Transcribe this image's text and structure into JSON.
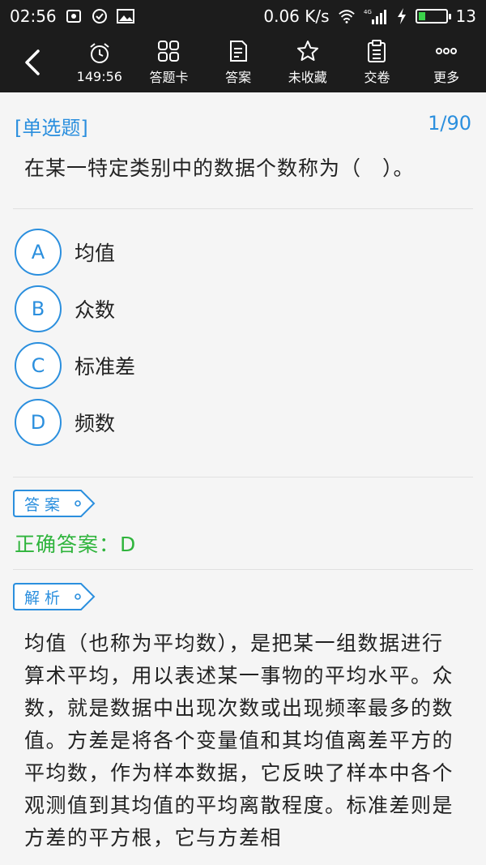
{
  "status_bar": {
    "time": "02:56",
    "network_speed": "0.06 K/s",
    "signal_label": "4G",
    "battery": "13",
    "left_icons": [
      "bug-icon",
      "check-circle-icon",
      "image-icon"
    ],
    "right_icons": [
      "wifi-icon",
      "signal-icon",
      "charging-icon",
      "battery-icon"
    ]
  },
  "toolbar": {
    "back_icon": "back-arrow-icon",
    "items": [
      {
        "icon": "alarm-clock-icon",
        "label": "149:56"
      },
      {
        "icon": "grid-icon",
        "label": "答题卡"
      },
      {
        "icon": "document-icon",
        "label": "答案"
      },
      {
        "icon": "star-icon",
        "label": "未收藏"
      },
      {
        "icon": "clipboard-icon",
        "label": "交卷"
      },
      {
        "icon": "more-dots-icon",
        "label": "更多"
      }
    ]
  },
  "question": {
    "type": "[单选题]",
    "progress": "1/90",
    "text": "在某一特定类别中的数据个数称为（　）。",
    "options": [
      {
        "letter": "A",
        "text": "均值"
      },
      {
        "letter": "B",
        "text": "众数"
      },
      {
        "letter": "C",
        "text": "标准差"
      },
      {
        "letter": "D",
        "text": "频数"
      }
    ]
  },
  "answer_section": {
    "tag": "答案",
    "correct_answer": "正确答案：D"
  },
  "analysis_section": {
    "tag": "解析",
    "text": "均值（也称为平均数），是把某一组数据进行算术平均，用以表述某一事物的平均水平。众数，就是数据中出现次数或出现频率最多的数值。方差是将各个变量值和其均值离差平方的平均数，作为样本数据，它反映了样本中各个观测值到其均值的平均离散程度。标准差则是方差的平方根，它与方差相"
  },
  "colors": {
    "accent": "#2b8fde",
    "correct": "#2fb43c",
    "toolbar_bg": "#1c1c1c",
    "page_bg": "#f5f5f5"
  }
}
